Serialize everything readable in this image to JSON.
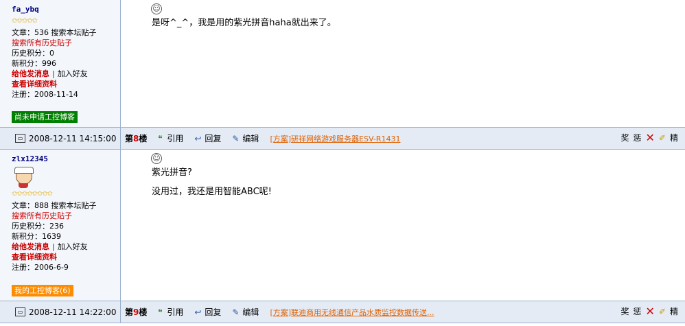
{
  "posts": [
    {
      "username": "fa_ybq",
      "stars": "✩✩✩✩✩",
      "post_count_label": "文章：536 搜索本坛贴子",
      "search_history": "搜索所有历史贴子",
      "history_points": "历史积分：0",
      "new_points": "新积分：996",
      "send_message": "给他发消息",
      "add_friend": "加入好友",
      "view_profile": "查看详细资料",
      "register_date": "注册：2008-11-14",
      "blog_badge": "尚未申请工控博客",
      "message_lines": [
        "是呀^_^，我是用的紫光拼音haha就出来了。"
      ],
      "timestamp": "2008-12-11 14:15:00",
      "floor_prefix": "第",
      "floor_num": "8",
      "floor_suffix": "楼",
      "quote": "引用",
      "reply": "回复",
      "edit": "编辑",
      "ad_link": "[方案]研祥网络游戏服务器ESV-R1431",
      "reward": "奖",
      "punish": "惩",
      "elite": "精"
    },
    {
      "username": "zlx12345",
      "stars": "✩✩✩✩✩✩✩✩",
      "post_count_label": "文章：888 搜索本坛贴子",
      "search_history": "搜索所有历史贴子",
      "history_points": "历史积分：236",
      "new_points": "新积分：1639",
      "send_message": "给他发消息",
      "add_friend": "加入好友",
      "view_profile": "查看详细资料",
      "register_date": "注册：2006-6-9",
      "blog_badge": "我的工控博客(6)",
      "message_lines": [
        "紫光拼音?",
        "没用过，我还是用智能ABC呢!"
      ],
      "timestamp": "2008-12-11 14:22:00",
      "floor_prefix": "第",
      "floor_num": "9",
      "floor_suffix": "楼",
      "quote": "引用",
      "reply": "回复",
      "edit": "编辑",
      "ad_link": "[方案]联迪商用无线通信产品水质监控数据传送...",
      "reward": "奖",
      "punish": "惩",
      "elite": "精"
    }
  ],
  "colors": {
    "accent_red": "#cc0000",
    "link_orange": "#e06000",
    "badge_green": "#008000",
    "badge_orange": "#ff8c00"
  },
  "icons": [
    "smiley-icon",
    "computer-icon",
    "quote-icon",
    "reply-icon",
    "edit-icon",
    "delete-icon",
    "tool-icon"
  ]
}
